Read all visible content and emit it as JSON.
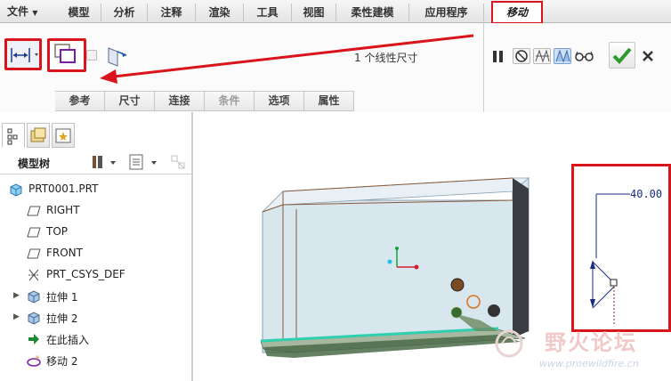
{
  "menubar": {
    "file_label": "文件",
    "tabs": [
      {
        "label": "模型"
      },
      {
        "label": "分析"
      },
      {
        "label": "注释"
      },
      {
        "label": "渲染"
      },
      {
        "label": "工具"
      },
      {
        "label": "视图"
      },
      {
        "label": "柔性建模"
      },
      {
        "label": "应用程序"
      }
    ],
    "active_tab": "移动"
  },
  "ribbon": {
    "status": "1 个线性尺寸",
    "subtabs": [
      {
        "label": "参考",
        "enabled": true
      },
      {
        "label": "尺寸",
        "enabled": true
      },
      {
        "label": "连接",
        "enabled": true
      },
      {
        "label": "条件",
        "enabled": false
      },
      {
        "label": "选项",
        "enabled": true
      },
      {
        "label": "属性",
        "enabled": true
      }
    ]
  },
  "model_tree": {
    "title": "模型树",
    "items": [
      {
        "label": "PRT0001.PRT",
        "icon": "part-icon"
      },
      {
        "label": "RIGHT",
        "icon": "datum-plane-icon"
      },
      {
        "label": "TOP",
        "icon": "datum-plane-icon"
      },
      {
        "label": "FRONT",
        "icon": "datum-plane-icon"
      },
      {
        "label": "PRT_CSYS_DEF",
        "icon": "csys-icon"
      },
      {
        "label": "拉伸 1",
        "icon": "extrude-icon"
      },
      {
        "label": "拉伸 2",
        "icon": "extrude-icon"
      },
      {
        "label": "在此插入",
        "icon": "insert-here-icon"
      },
      {
        "label": "移动 2",
        "icon": "move-feature-icon"
      }
    ]
  },
  "viewport": {
    "dimension_value": "40.00"
  },
  "watermark": {
    "text_cn": "野火论坛",
    "url": "www.proewildfire.cn"
  },
  "colors": {
    "highlight_red": "#d9151b",
    "accept_green": "#2c9a2c",
    "part_face": "#d8e6ee",
    "edge_brown": "#8a5a3a",
    "dimension_blue": "#1a2a80",
    "teal_edge": "#2fd0b0"
  }
}
